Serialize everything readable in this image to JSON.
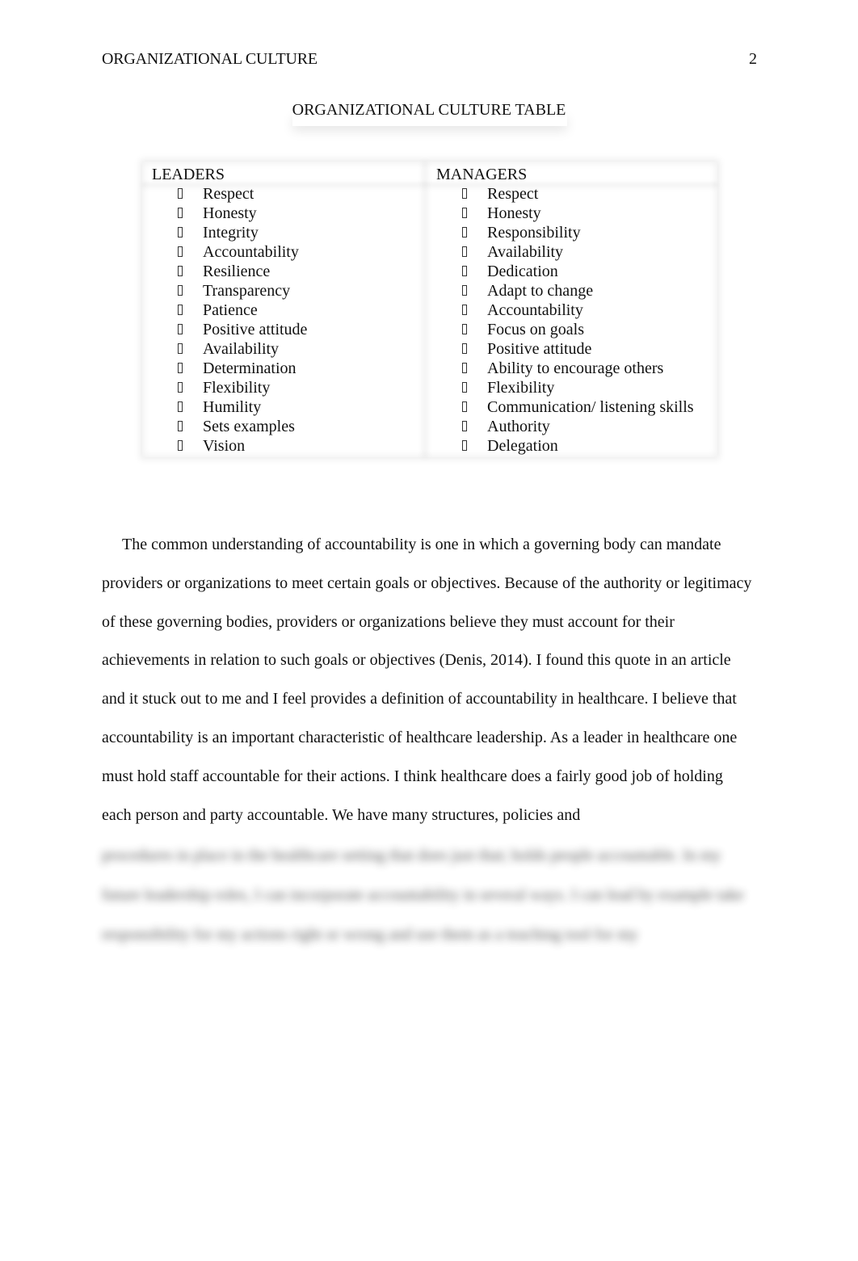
{
  "header": {
    "running_head": "ORGANIZATIONAL CULTURE",
    "page_number": "2"
  },
  "table": {
    "title": "ORGANIZATIONAL CULTURE TABLE",
    "bullet_icon": "missing-glyph-box",
    "columns": [
      {
        "heading": "LEADERS",
        "items": [
          "Respect",
          "Honesty",
          "Integrity",
          "Accountability",
          "Resilience",
          "Transparency",
          "Patience",
          "Positive attitude",
          "Availability",
          "Determination",
          "Flexibility",
          "Humility",
          "Sets examples",
          "Vision"
        ]
      },
      {
        "heading": "MANAGERS",
        "items": [
          "Respect",
          "Honesty",
          "Responsibility",
          "Availability",
          "Dedication",
          "Adapt to change",
          "Accountability",
          "Focus on goals",
          "Positive attitude",
          "Ability to encourage others",
          "Flexibility",
          "Communication/ listening skills",
          "Authority",
          "Delegation"
        ]
      }
    ]
  },
  "body": {
    "paragraph": "The common understanding of accountability is one in which a governing body can mandate providers or organizations to meet certain goals or objectives. Because of the authority or legitimacy of these governing bodies, providers or organizations believe they must account for their achievements in relation to such goals or objectives (Denis, 2014). I found this quote in an article and it stuck out to me and I feel provides a definition of accountability in healthcare. I believe that accountability is an important characteristic of healthcare leadership. As a leader in healthcare one must hold staff accountable for their actions. I think healthcare does a fairly good job of holding each person and party accountable. We have many structures, policies and",
    "blurred_text": "procedures in place in the healthcare setting that does just that; holds people accountable. In my future leadership roles, I can incorporate accountability in several ways. I can lead by example take responsibility for my actions right or wrong and use them as a teaching tool for my"
  }
}
